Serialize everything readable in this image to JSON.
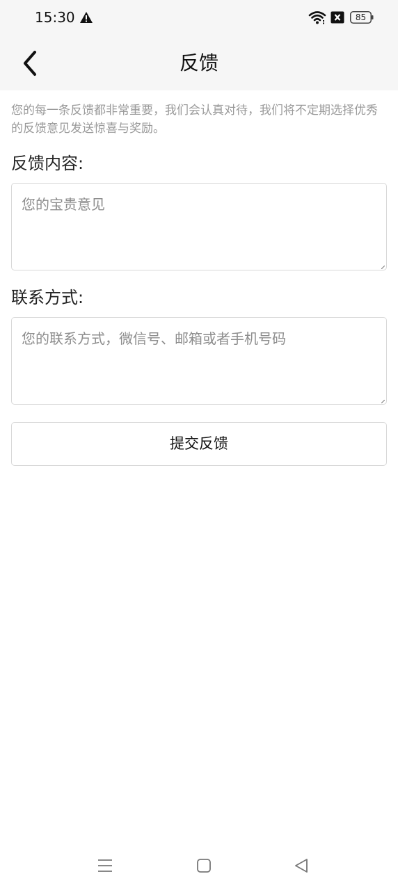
{
  "status_bar": {
    "time": "15:30",
    "battery": "85",
    "icons": [
      "warning-icon",
      "wifi-icon",
      "no-sim-icon",
      "battery-icon"
    ]
  },
  "header": {
    "title": "反馈",
    "back_icon": "chevron-left-icon"
  },
  "intro": "您的每一条反馈都非常重要，我们会认真对待，我们将不定期选择优秀的反馈意见发送惊喜与奖励。",
  "feedback": {
    "label": "反馈内容:",
    "placeholder": "您的宝贵意见",
    "value": ""
  },
  "contact": {
    "label": "联系方式:",
    "placeholder": "您的联系方式，微信号、邮箱或者手机号码",
    "value": ""
  },
  "submit_label": "提交反馈",
  "nav_bar": {
    "icons": [
      "menu-icon",
      "home-icon",
      "back-triangle-icon"
    ]
  },
  "colors": {
    "top_background": "#f6f6f6",
    "hint_text": "#9a9a9a",
    "border": "#d8d8d8"
  }
}
